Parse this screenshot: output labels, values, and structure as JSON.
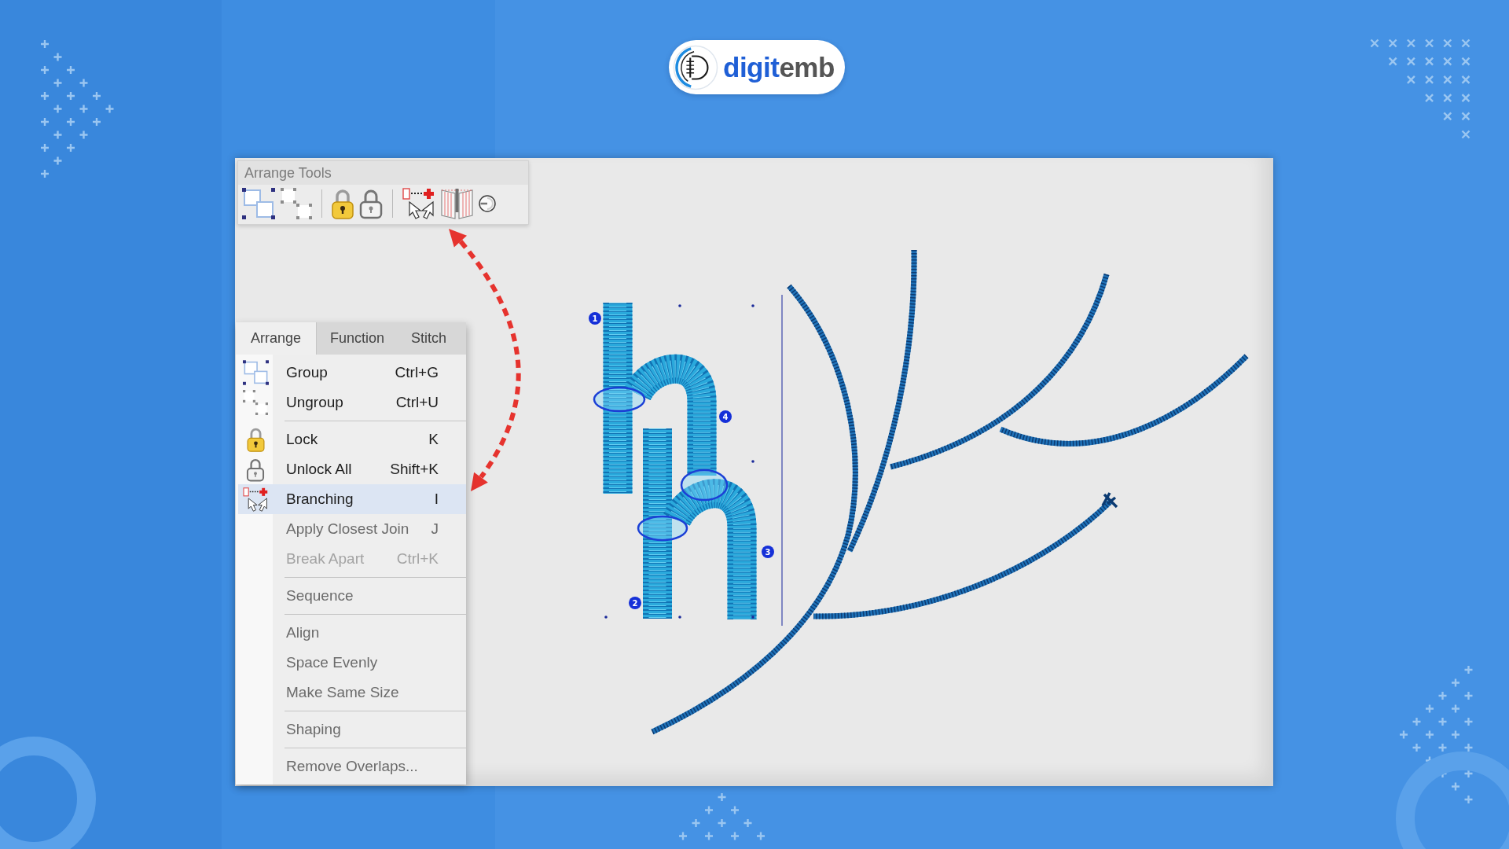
{
  "logo": {
    "wordmark_start": "digit",
    "wordmark_end": "emb"
  },
  "toolbar": {
    "title": "Arrange Tools"
  },
  "menu": {
    "tabs": [
      {
        "label": "Arrange",
        "selected": true
      },
      {
        "label": "Function",
        "selected": false
      },
      {
        "label": "Stitch",
        "selected": false
      }
    ],
    "sections": [
      {
        "items": [
          {
            "label": "Group",
            "shortcut": "Ctrl+G",
            "selected": false,
            "dimmed": false,
            "disabled": false
          },
          {
            "label": "Ungroup",
            "shortcut": "Ctrl+U",
            "selected": false,
            "dimmed": false,
            "disabled": false
          }
        ]
      },
      {
        "items": [
          {
            "label": "Lock",
            "shortcut": "K",
            "selected": false,
            "dimmed": false,
            "disabled": false
          },
          {
            "label": "Unlock All",
            "shortcut": "Shift+K",
            "selected": false,
            "dimmed": false,
            "disabled": false
          },
          {
            "label": "Branching",
            "shortcut": "I",
            "selected": true,
            "dimmed": false,
            "disabled": false
          },
          {
            "label": "Apply Closest Join",
            "shortcut": "J",
            "selected": false,
            "dimmed": true,
            "disabled": false
          },
          {
            "label": "Break Apart",
            "shortcut": "Ctrl+K",
            "selected": false,
            "dimmed": false,
            "disabled": true
          }
        ]
      },
      {
        "items": [
          {
            "label": "Sequence",
            "selected": false,
            "dimmed": true,
            "disabled": false
          }
        ]
      },
      {
        "items": [
          {
            "label": "Align",
            "selected": false,
            "dimmed": true,
            "disabled": false
          },
          {
            "label": "Space Evenly",
            "selected": false,
            "dimmed": true,
            "disabled": false
          },
          {
            "label": "Make Same Size",
            "selected": false,
            "dimmed": true,
            "disabled": false
          }
        ]
      },
      {
        "items": [
          {
            "label": "Shaping",
            "selected": false,
            "dimmed": true,
            "disabled": false
          }
        ]
      },
      {
        "items": [
          {
            "label": "Remove Overlaps...",
            "selected": false,
            "dimmed": true,
            "disabled": false
          }
        ]
      }
    ]
  },
  "canvas": {
    "sequence_markers": [
      {
        "label": "1"
      },
      {
        "label": "2"
      },
      {
        "label": "3"
      },
      {
        "label": "4"
      }
    ]
  }
}
